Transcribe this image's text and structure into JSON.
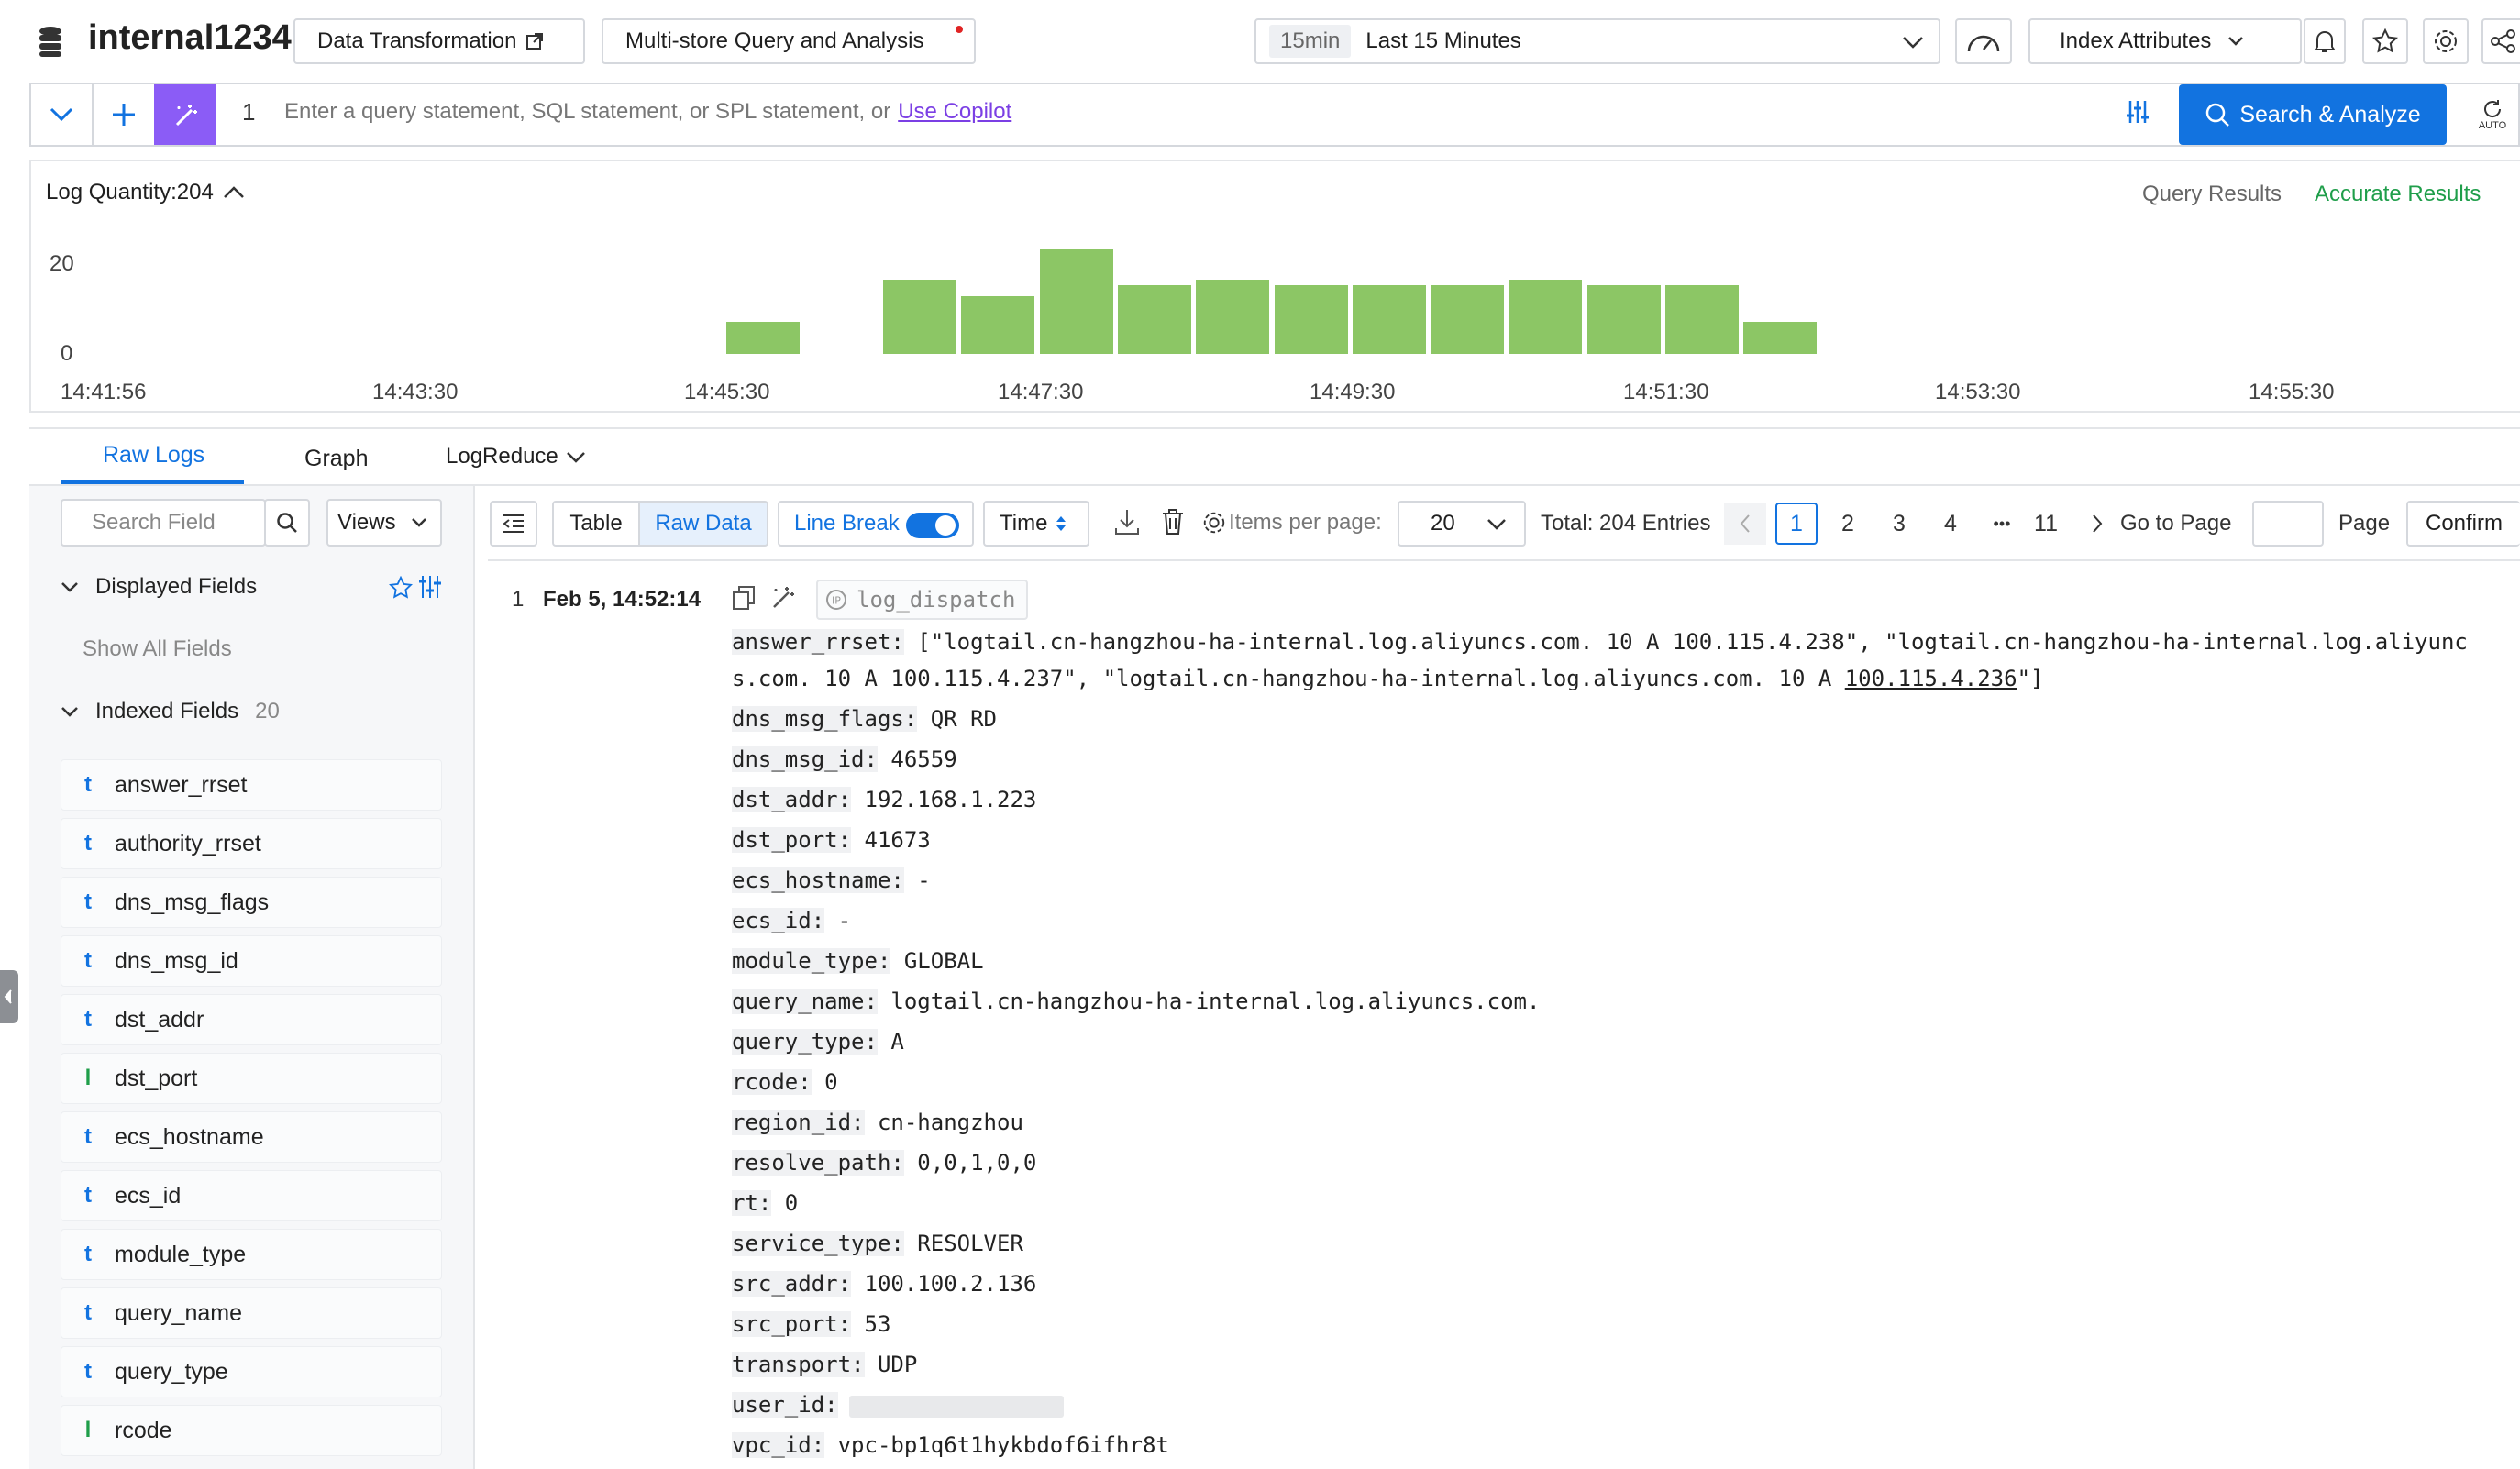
{
  "header": {
    "store_name": "internal1234",
    "data_transformation": "Data Transformation",
    "multistore": "Multi-store Query and Analysis",
    "time_badge": "15min",
    "time_range": "Last 15  Minutes",
    "index_attributes": "Index Attributes"
  },
  "query": {
    "line_number": "1",
    "placeholder": "Enter a query statement, SQL statement, or SPL statement, or",
    "copilot_link": "Use Copilot",
    "search_button": "Search & Analyze",
    "auto_label": "AUTO"
  },
  "histogram": {
    "log_quantity": "Log Quantity:204",
    "query_results": "Query Results",
    "accurate_results": "Accurate Results"
  },
  "chart_data": {
    "type": "bar",
    "y_ticks": [
      "20",
      "0"
    ],
    "x_ticks": [
      "14:41:56",
      "14:43:30",
      "14:45:30",
      "14:47:30",
      "14:49:30",
      "14:51:30",
      "14:53:30",
      "14:55:30"
    ],
    "ylim": [
      0,
      24
    ],
    "values": [
      0,
      0,
      0,
      0,
      0,
      0,
      0,
      0,
      6,
      0,
      14,
      11,
      20,
      13,
      14,
      13,
      13,
      13,
      14,
      13,
      13,
      6,
      0,
      0,
      0,
      0,
      0,
      0,
      0,
      0,
      0
    ]
  },
  "tabs": {
    "raw_logs": "Raw Logs",
    "graph": "Graph",
    "logreduce": "LogReduce"
  },
  "sidebar": {
    "search_placeholder": "Search Field",
    "views": "Views",
    "displayed_fields": "Displayed Fields",
    "show_all_fields": "Show All Fields",
    "indexed_fields": "Indexed Fields",
    "indexed_count": "20",
    "fields": [
      {
        "type": "t",
        "name": "answer_rrset"
      },
      {
        "type": "t",
        "name": "authority_rrset"
      },
      {
        "type": "t",
        "name": "dns_msg_flags"
      },
      {
        "type": "t",
        "name": "dns_msg_id"
      },
      {
        "type": "t",
        "name": "dst_addr"
      },
      {
        "type": "l",
        "name": "dst_port"
      },
      {
        "type": "t",
        "name": "ecs_hostname"
      },
      {
        "type": "t",
        "name": "ecs_id"
      },
      {
        "type": "t",
        "name": "module_type"
      },
      {
        "type": "t",
        "name": "query_name"
      },
      {
        "type": "t",
        "name": "query_type"
      },
      {
        "type": "l",
        "name": "rcode"
      }
    ]
  },
  "toolbar": {
    "table": "Table",
    "raw_data": "Raw Data",
    "line_break": "Line Break",
    "time": "Time",
    "items_per_page_label": "Items per page:",
    "items_per_page": "20",
    "total": "Total: 204 Entries",
    "pages": [
      "1",
      "2",
      "3",
      "4",
      "11"
    ],
    "ellipsis": "•••",
    "go_to_page": "Go to Page",
    "page": "Page",
    "confirm": "Confirm"
  },
  "log": {
    "index": "1",
    "timestamp": "Feb 5, 14:52:14",
    "topic": "log_dispatch",
    "answer_rrset_key": "answer_rrset:",
    "answer_rrset_line1": " [\"logtail.cn-hangzhou-ha-internal.log.aliyuncs.com. 10 A 100.115.4.238\", \"logtail.cn-hangzhou-ha-internal.log.aliyunc",
    "answer_rrset_line2a": "s.com. 10 A 100.115.4.237\", \"logtail.cn-hangzhou-ha-internal.log.aliyuncs.com. 10 A ",
    "answer_rrset_line2_link": "100.115.4.236",
    "answer_rrset_line2b": "\"]",
    "fields": [
      {
        "key": "dns_msg_flags:",
        "value": " QR RD"
      },
      {
        "key": "dns_msg_id:",
        "value": " 46559"
      },
      {
        "key": "dst_addr:",
        "value": " 192.168.1.223"
      },
      {
        "key": "dst_port:",
        "value": " 41673"
      },
      {
        "key": "ecs_hostname:",
        "value": " -"
      },
      {
        "key": "ecs_id:",
        "value": " -"
      },
      {
        "key": "module_type:",
        "value": " GLOBAL"
      },
      {
        "key": "query_name:",
        "value": " logtail.cn-hangzhou-ha-internal.log.aliyuncs.com."
      },
      {
        "key": "query_type:",
        "value": " A"
      },
      {
        "key": "rcode:",
        "value": " 0"
      },
      {
        "key": "region_id:",
        "value": " cn-hangzhou"
      },
      {
        "key": "resolve_path:",
        "value": " 0,0,1,0,0"
      },
      {
        "key": "rt:",
        "value": " 0"
      },
      {
        "key": "service_type:",
        "value": " RESOLVER"
      },
      {
        "key": "src_addr:",
        "value": " 100.100.2.136"
      },
      {
        "key": "src_port:",
        "value": " 53"
      },
      {
        "key": "transport:",
        "value": " UDP"
      },
      {
        "key": "user_id:",
        "value": ""
      },
      {
        "key": "vpc_id:",
        "value": " vpc-bp1q6t1hykbdof6ifhr8t"
      }
    ]
  },
  "colors": {
    "accent": "#1273e0",
    "bar": "#8cc665",
    "accurate": "#1f9e4a"
  }
}
